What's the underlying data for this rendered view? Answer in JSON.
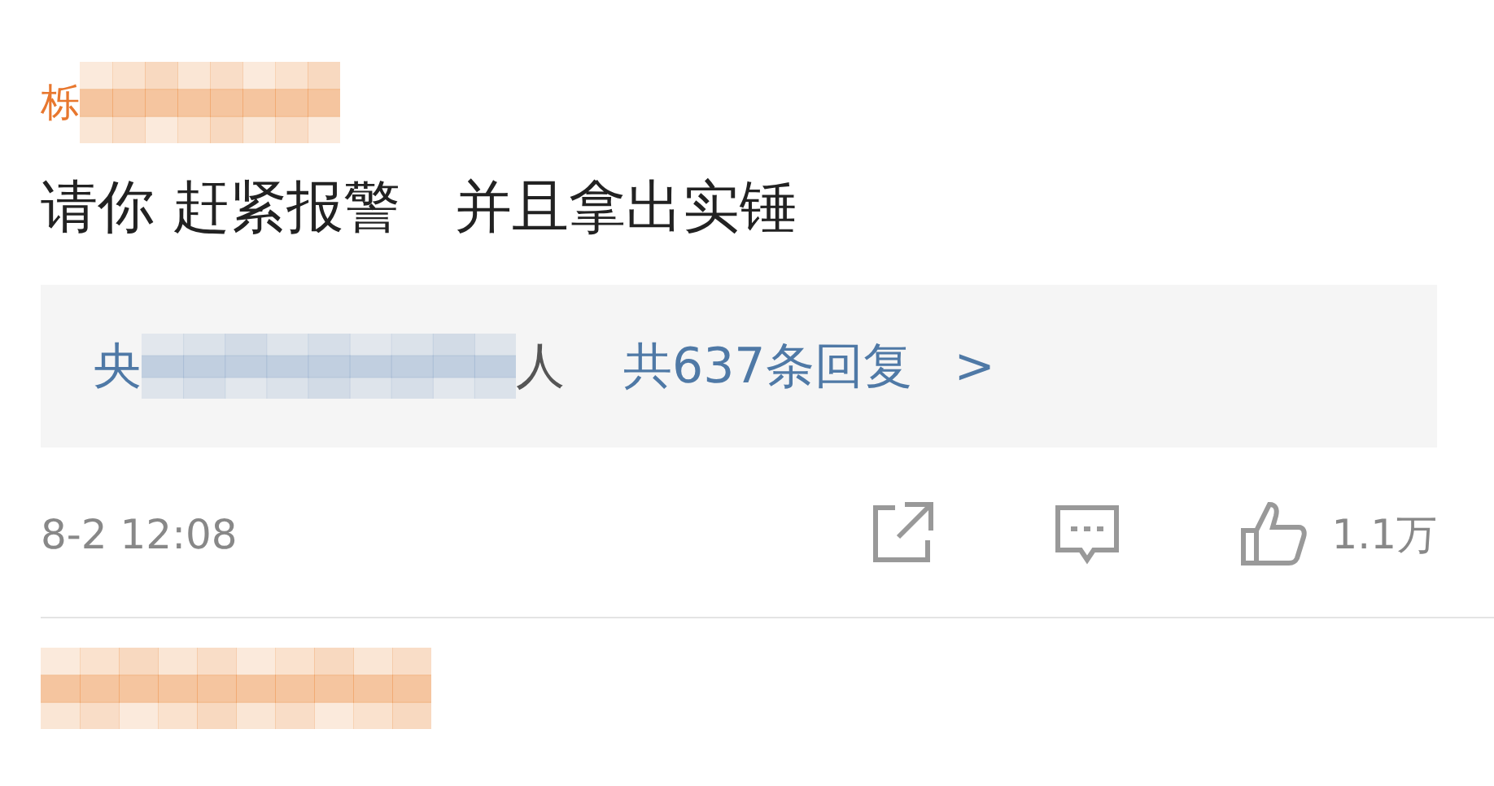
{
  "comments": [
    {
      "kind": "full",
      "author": "栎",
      "text": "请你 赶紧报警   并且拿出实锤",
      "replies": {
        "first": "央",
        "last": "人",
        "count": "共637条回复",
        "chevron": ">"
      },
      "time": "8-2  12:08",
      "likes": "1.1万"
    },
    {
      "kind": "cut_off"
    }
  ]
}
